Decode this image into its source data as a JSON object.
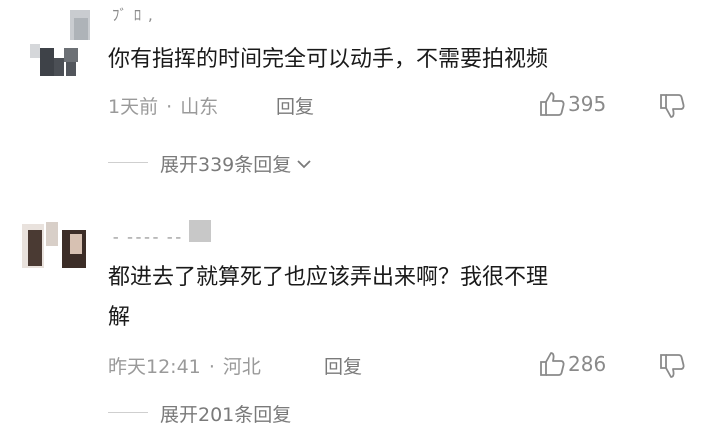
{
  "comments": [
    {
      "username": "ﾌﾞ ﾛ ,",
      "text": "你有指挥的时间完全可以动手，不需要拍视频",
      "time": "1天前",
      "sep": "·",
      "location": "山东",
      "reply_label": "回复",
      "likes": "395",
      "expand_label": "展开339条回复"
    },
    {
      "username": "ˍ ˍˍˍˍ ˍˍ",
      "text_line1": "都进去了就算死了也应该弄出来啊？我很不理",
      "text_line2": "解",
      "time": "昨天12:41",
      "sep": "·",
      "location": "河北",
      "reply_label": "回复",
      "likes": "286",
      "expand_label": "展开201条回复"
    }
  ],
  "icons": [
    "avatar",
    "thumb-up-icon",
    "thumb-down-icon",
    "chevron-down-icon"
  ]
}
